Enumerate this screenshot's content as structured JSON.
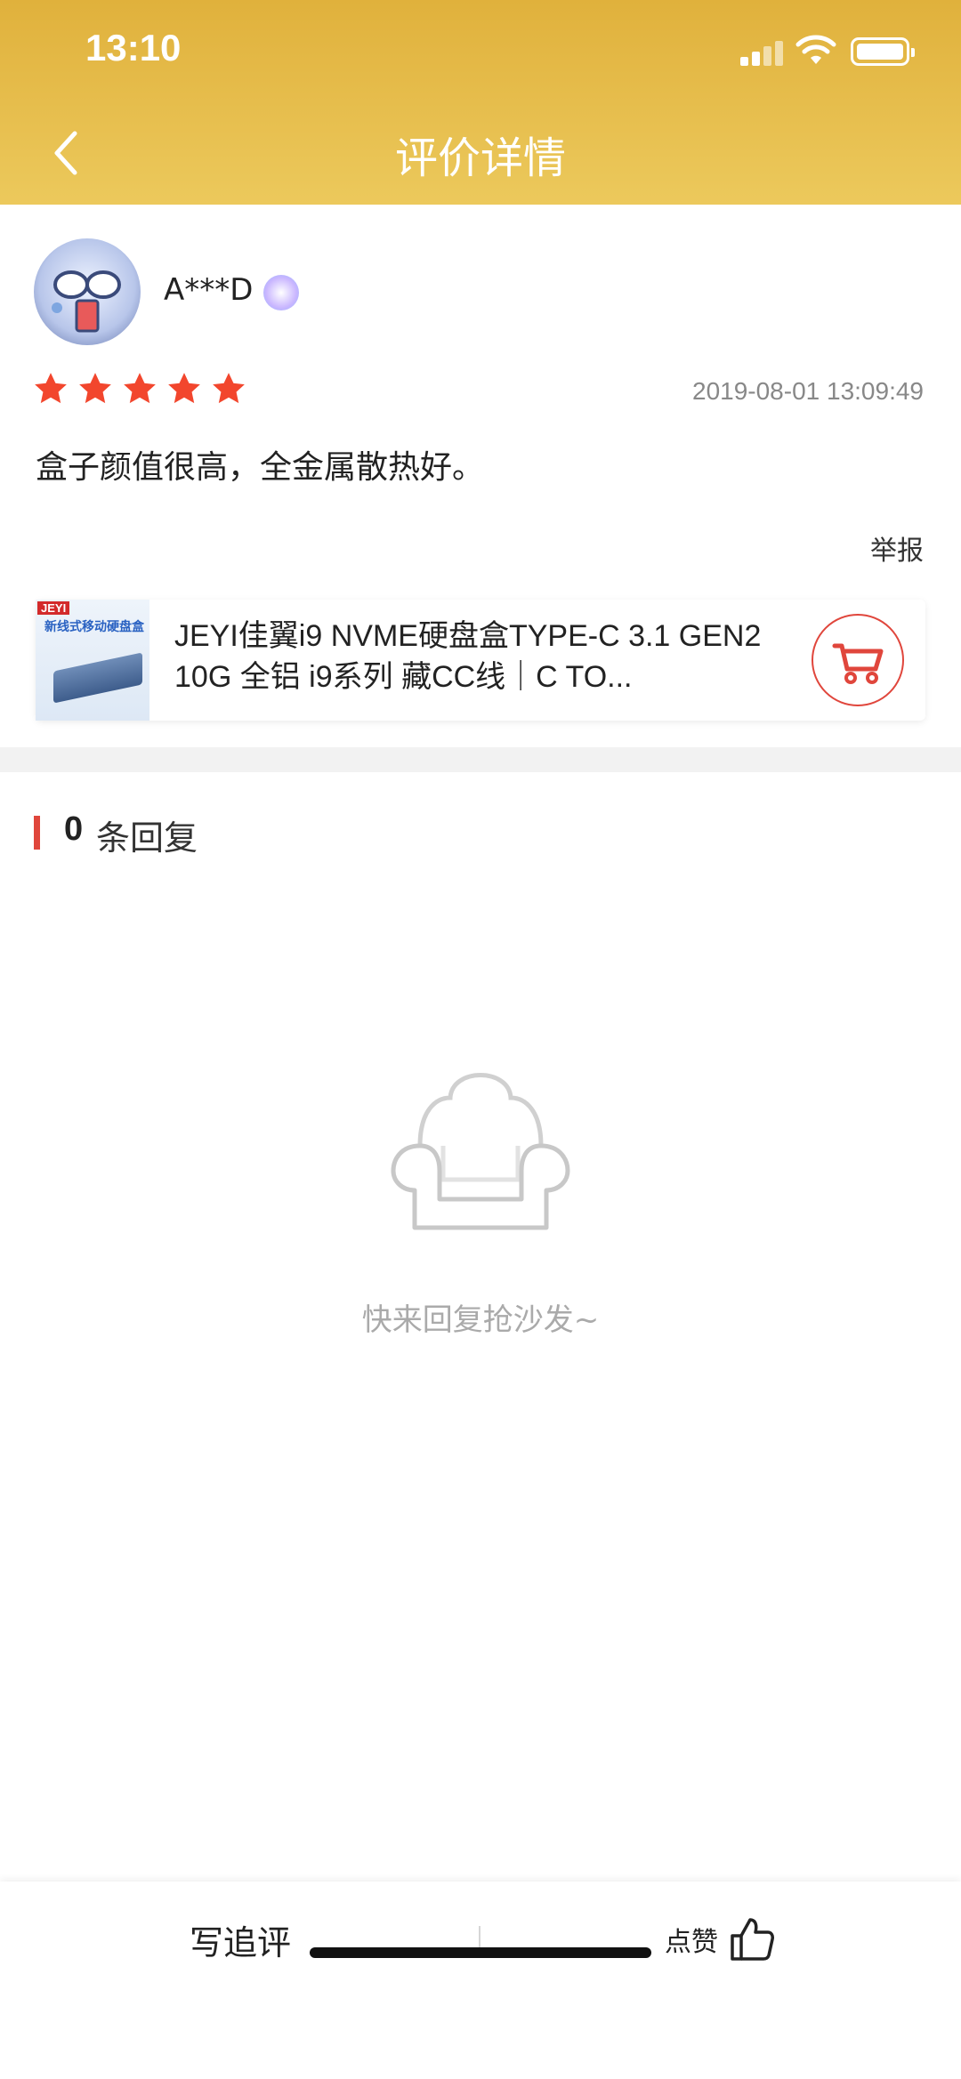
{
  "status_bar": {
    "time": "13:10"
  },
  "nav": {
    "title": "评价详情",
    "back_icon": "chevron-left-icon"
  },
  "review": {
    "username": "A***D",
    "rating": 5,
    "rating_max": 5,
    "date": "2019-08-01 13:09:49",
    "content": "盒子颜值很高，全金属散热好。",
    "report_label": "举报"
  },
  "product": {
    "image_brand": "JEYI",
    "image_tagline": "新线式移动硬盘盒",
    "title": "JEYI佳翼i9 NVME硬盘盒TYPE-C 3.1 GEN2 10G 全铝 i9系列 藏CC线｜C TO...",
    "cart_icon": "cart-icon"
  },
  "replies": {
    "count": "0",
    "label": "条回复"
  },
  "empty_state": {
    "icon": "sofa-icon",
    "text": "快来回复抢沙发~"
  },
  "bottom_bar": {
    "write_label": "写追评",
    "like_label": "点赞",
    "like_icon": "thumbs-up-icon"
  },
  "colors": {
    "header_top": "#e0b13c",
    "header_bottom": "#ecc95c",
    "accent_red": "#e0463c",
    "star_color": "#f2462d"
  }
}
